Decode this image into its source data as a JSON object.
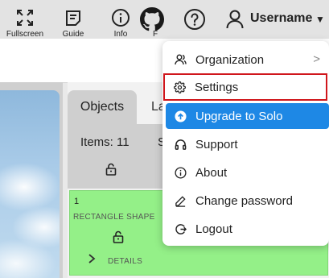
{
  "header": {
    "username": "Username",
    "icons": [
      "github-icon",
      "help-icon",
      "user-icon",
      "caret-down-icon"
    ]
  },
  "toolbar": {
    "items": [
      {
        "label": "Fullscreen",
        "icon": "fullscreen-icon"
      },
      {
        "label": "Guide",
        "icon": "guide-icon"
      },
      {
        "label": "Info",
        "icon": "info-icon"
      },
      {
        "label": "F",
        "icon": "partial-icon"
      }
    ]
  },
  "panel": {
    "tabs": [
      {
        "label": "Objects"
      },
      {
        "label": "La"
      }
    ],
    "items_count": "Items: 11",
    "partial_s": "S",
    "card": {
      "number": "1",
      "type": "RECTANGLE SHAPE",
      "details": "DETAILS"
    }
  },
  "menu": {
    "items": [
      {
        "label": "Organization",
        "icon": "organization-icon",
        "has_submenu": true
      },
      {
        "label": "Settings",
        "icon": "gear-icon",
        "highlighted": true
      },
      {
        "label": "Upgrade to Solo",
        "icon": "upgrade-icon"
      },
      {
        "label": "Support",
        "icon": "headset-icon"
      },
      {
        "label": "About",
        "icon": "info-icon"
      },
      {
        "label": "Change password",
        "icon": "pencil-icon"
      },
      {
        "label": "Logout",
        "icon": "logout-icon"
      }
    ],
    "submenu_arrow": ">"
  },
  "colors": {
    "accent": "#1e88e5",
    "highlight_border": "#d0161c",
    "card_bg": "#94f088"
  }
}
